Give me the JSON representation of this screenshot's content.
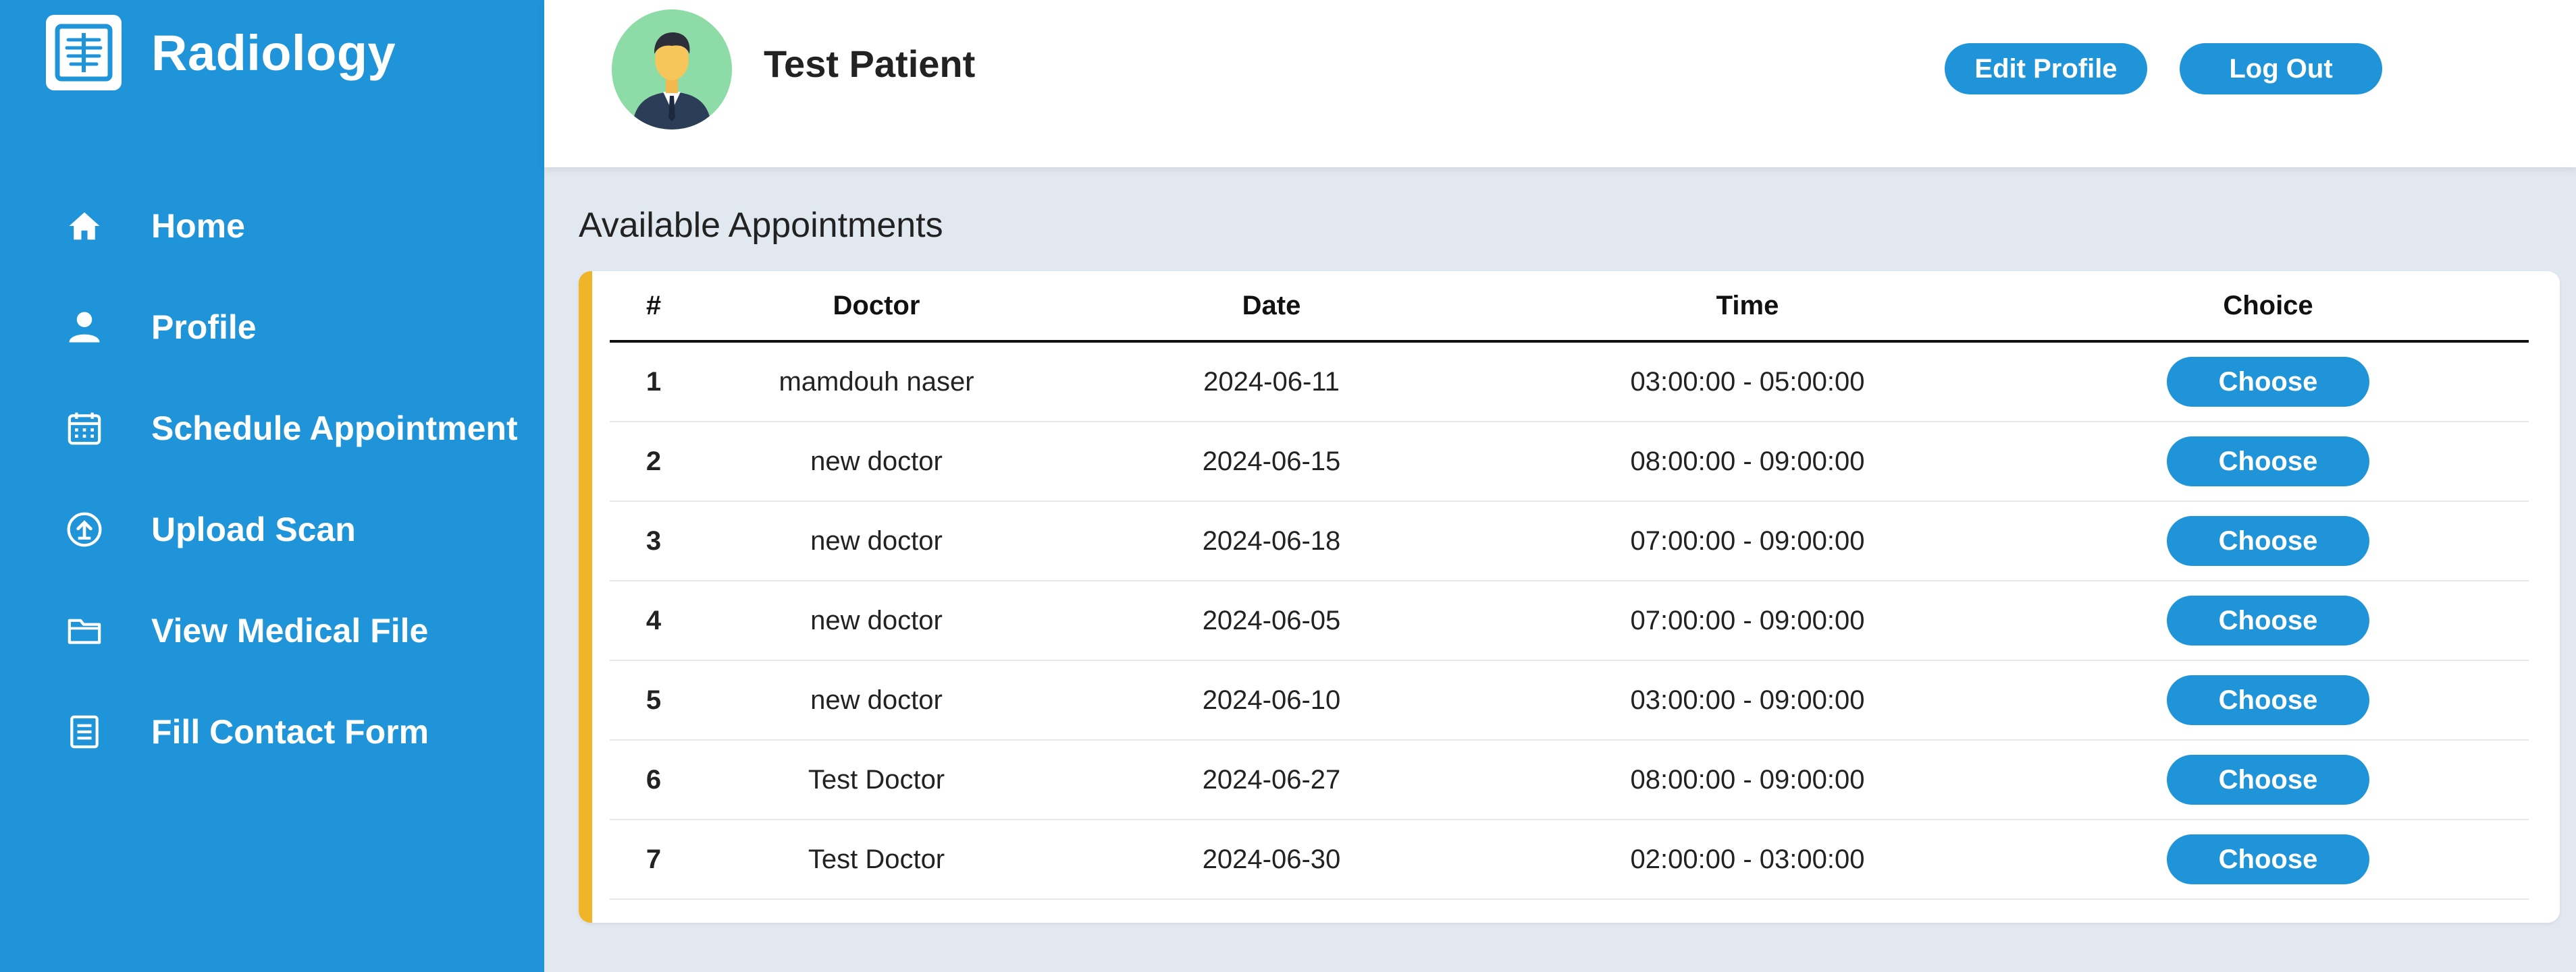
{
  "brand": {
    "title": "Radiology",
    "icon": "xray-icon"
  },
  "sidebar": {
    "items": [
      {
        "label": "Home",
        "icon": "home-icon"
      },
      {
        "label": "Profile",
        "icon": "user-icon"
      },
      {
        "label": "Schedule Appointment",
        "icon": "calendar-icon"
      },
      {
        "label": "Upload Scan",
        "icon": "upload-icon"
      },
      {
        "label": "View Medical File",
        "icon": "folder-icon"
      },
      {
        "label": "Fill Contact Form",
        "icon": "form-icon"
      }
    ]
  },
  "header": {
    "patient_name": "Test Patient",
    "edit_profile_label": "Edit Profile",
    "logout_label": "Log Out"
  },
  "main": {
    "section_title": "Available Appointments",
    "columns": [
      "#",
      "Doctor",
      "Date",
      "Time",
      "Choice"
    ],
    "choose_label": "Choose",
    "rows": [
      {
        "num": "1",
        "doctor": "mamdouh naser",
        "date": "2024-06-11",
        "time": "03:00:00 - 05:00:00"
      },
      {
        "num": "2",
        "doctor": "new doctor",
        "date": "2024-06-15",
        "time": "08:00:00 - 09:00:00"
      },
      {
        "num": "3",
        "doctor": "new doctor",
        "date": "2024-06-18",
        "time": "07:00:00 - 09:00:00"
      },
      {
        "num": "4",
        "doctor": "new doctor",
        "date": "2024-06-05",
        "time": "07:00:00 - 09:00:00"
      },
      {
        "num": "5",
        "doctor": "new doctor",
        "date": "2024-06-10",
        "time": "03:00:00 - 09:00:00"
      },
      {
        "num": "6",
        "doctor": "Test Doctor",
        "date": "2024-06-27",
        "time": "08:00:00 - 09:00:00"
      },
      {
        "num": "7",
        "doctor": "Test Doctor",
        "date": "2024-06-30",
        "time": "02:00:00 - 03:00:00"
      }
    ]
  },
  "colors": {
    "primary": "#1f94d9",
    "accent": "#f0b429",
    "background": "#e2e8f0"
  }
}
